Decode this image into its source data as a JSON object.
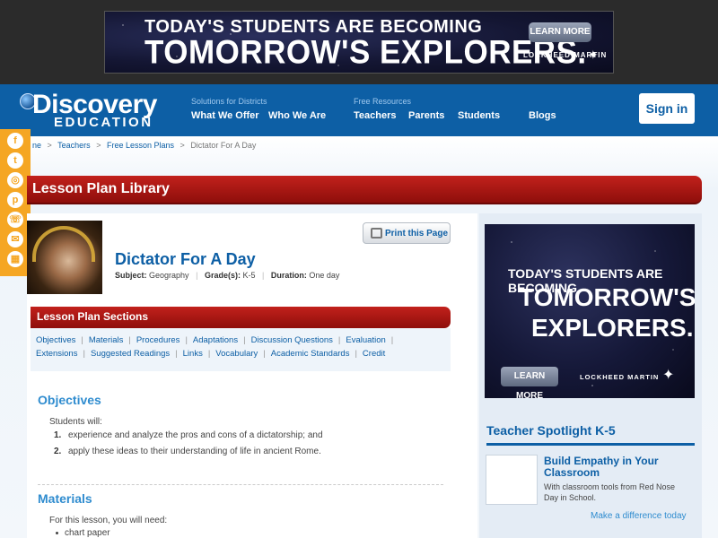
{
  "top_ad": {
    "line1": "TODAY'S STUDENTS ARE BECOMING",
    "line2": "TOMORROW'S EXPLORERS.",
    "cta": "LEARN MORE",
    "brand": "LOCKHEED MARTIN"
  },
  "header": {
    "logo_top": "Discovery",
    "logo_bottom": "EDUCATION",
    "districts_label": "Solutions for Districts",
    "resources_label": "Free Resources",
    "nav": [
      "What We Offer",
      "Who We Are",
      "Teachers",
      "Parents",
      "Students",
      "Blogs"
    ],
    "signin": "Sign in"
  },
  "breadcrumb": {
    "items": [
      "ne",
      "Teachers",
      "Free Lesson Plans",
      "Dictator For A Day"
    ],
    "sep": ">"
  },
  "social_icons": [
    "facebook-icon",
    "twitter-icon",
    "instagram-icon",
    "pinterest-icon",
    "phone-icon",
    "email-icon",
    "calendar-icon"
  ],
  "library_title": "Lesson Plan Library",
  "lesson": {
    "print_label": "Print this Page",
    "title": "Dictator For A Day",
    "subject_label": "Subject:",
    "subject": "Geography",
    "grade_label": "Grade(s):",
    "grade": "K-5",
    "duration_label": "Duration:",
    "duration": "One day"
  },
  "sections": {
    "title": "Lesson Plan Sections",
    "row1": [
      "Objectives",
      "Materials",
      "Procedures",
      "Adaptations",
      "Discussion Questions",
      "Evaluation"
    ],
    "row2": [
      "Extensions",
      "Suggested Readings",
      "Links",
      "Vocabulary",
      "Academic Standards",
      "Credit"
    ]
  },
  "objectives": {
    "heading": "Objectives",
    "intro": "Students will:",
    "items": [
      "experience and analyze the pros and cons of a dictatorship; and",
      "apply these ideas to their understanding of life in ancient Rome."
    ],
    "numbers": [
      "1.",
      "2."
    ]
  },
  "materials": {
    "heading": "Materials",
    "intro": "For this lesson, you will need:",
    "items": [
      "chart paper"
    ]
  },
  "side_ad": {
    "line1": "TODAY'S STUDENTS ARE BECOMING",
    "line2": "TOMORROW'S",
    "line3": "EXPLORERS.",
    "cta": "LEARN MORE",
    "brand": "LOCKHEED MARTIN"
  },
  "spotlight": {
    "title": "Teacher Spotlight K-5",
    "headline": "Build Empathy in Your Classroom",
    "description": "With classroom tools from Red Nose Day in School.",
    "link": "Make a difference today"
  }
}
